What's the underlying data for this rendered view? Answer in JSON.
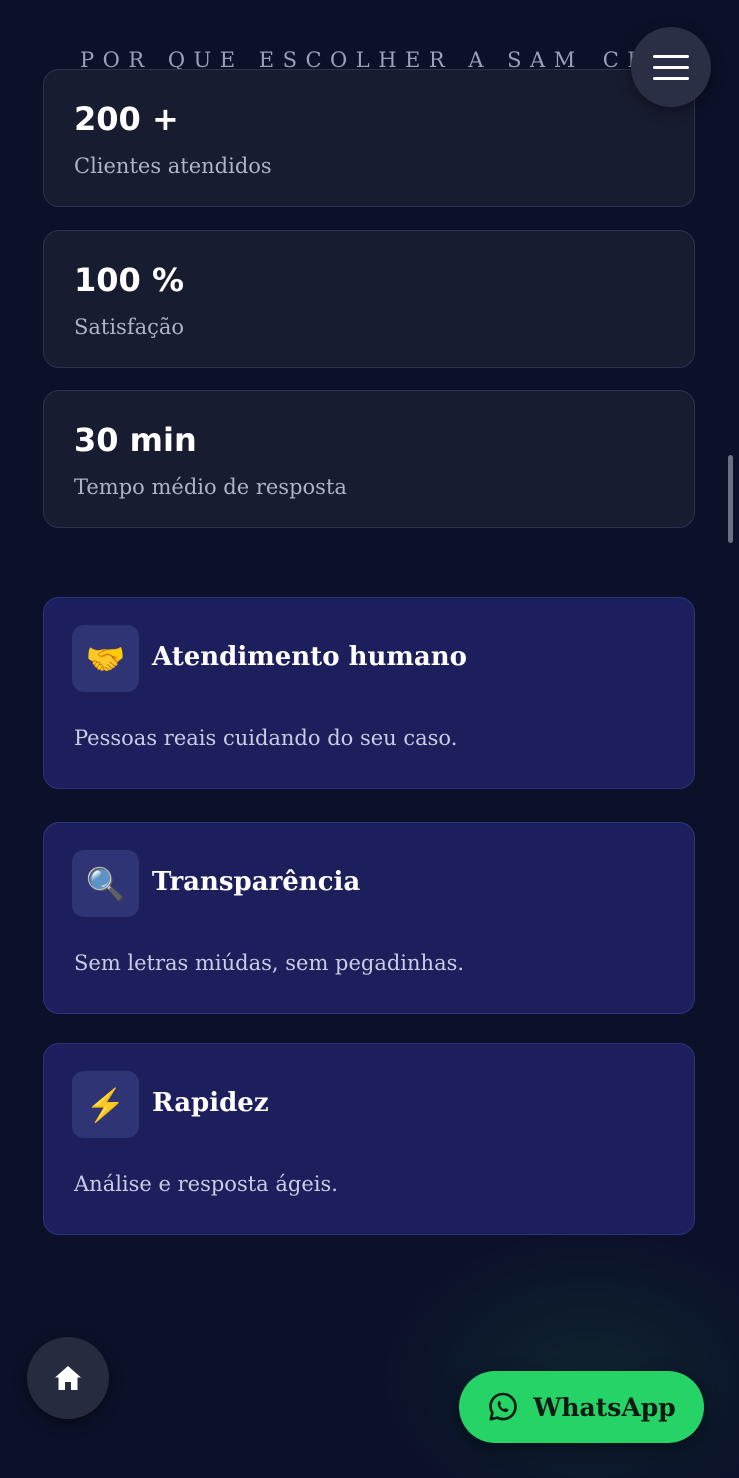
{
  "header": {
    "section_title": "POR QUE ESCOLHER A SAM_CRED"
  },
  "menu": {
    "icon": "hamburger-menu-icon"
  },
  "stats": [
    {
      "value": "200 +",
      "label": "Clientes atendidos"
    },
    {
      "value": "100 %",
      "label": "Satisfação"
    },
    {
      "value": "30 min",
      "label": "Tempo médio de resposta"
    }
  ],
  "features": [
    {
      "icon": "🤝",
      "icon_name": "handshake-icon",
      "title": "Atendimento humano",
      "text": "Pessoas reais cuidando do seu caso."
    },
    {
      "icon": "🔍",
      "icon_name": "magnifier-icon",
      "title": "Transparência",
      "text": "Sem letras miúdas, sem pegadinhas."
    },
    {
      "icon": "⚡",
      "icon_name": "lightning-icon",
      "title": "Rapidez",
      "text": "Análise e resposta ágeis."
    }
  ],
  "floating": {
    "home_icon": "home-icon",
    "whatsapp_label": "WhatsApp",
    "whatsapp_icon": "whatsapp-icon"
  },
  "colors": {
    "background": "#0b1129",
    "stat_card": "#171c31",
    "feature_card": "#1d1f5c",
    "whatsapp_green": "#25d366"
  }
}
